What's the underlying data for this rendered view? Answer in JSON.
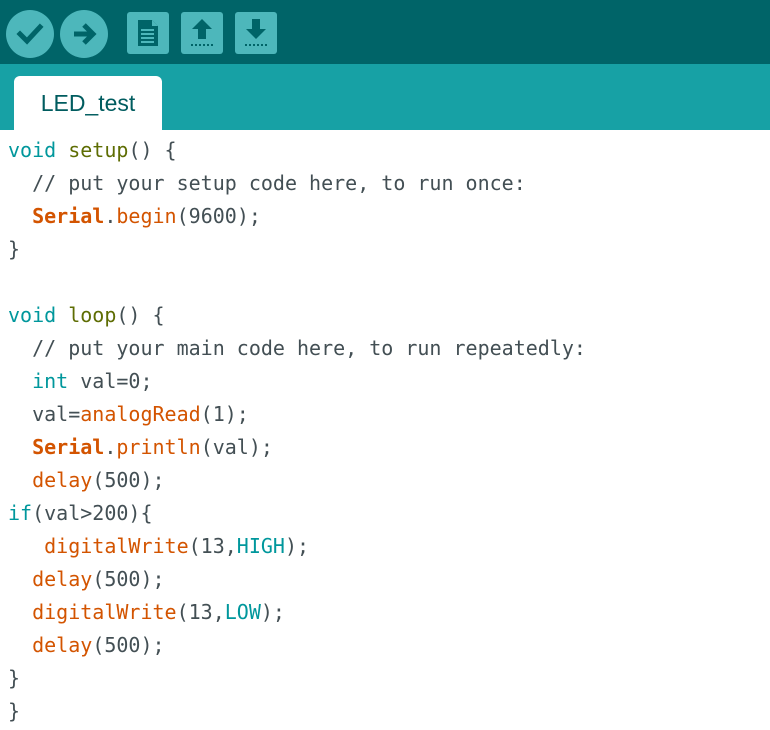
{
  "toolbar": {
    "buttons": [
      {
        "name": "verify",
        "icon": "check-icon"
      },
      {
        "name": "upload",
        "icon": "arrow-right-icon"
      },
      {
        "name": "new",
        "icon": "new-file-icon"
      },
      {
        "name": "open",
        "icon": "arrow-up-icon"
      },
      {
        "name": "save",
        "icon": "arrow-down-icon"
      }
    ],
    "colors": {
      "bar": "#006468",
      "button": "#4db7bb",
      "icon": "#006468"
    }
  },
  "tabs": [
    {
      "label": "LED_test",
      "active": true
    }
  ],
  "code": {
    "lines": [
      [
        [
          "kw",
          "void"
        ],
        [
          "p",
          " "
        ],
        [
          "st",
          "setup"
        ],
        [
          "p",
          "() {"
        ]
      ],
      [
        [
          "cm",
          "  // put your setup code here, to run once:"
        ]
      ],
      [
        [
          "p",
          "  "
        ],
        [
          "obj",
          "Serial"
        ],
        [
          "p",
          "."
        ],
        [
          "fn",
          "begin"
        ],
        [
          "p",
          "(9600);"
        ]
      ],
      [
        [
          "p",
          "}"
        ]
      ],
      [
        [
          "p",
          ""
        ]
      ],
      [
        [
          "kw",
          "void"
        ],
        [
          "p",
          " "
        ],
        [
          "st",
          "loop"
        ],
        [
          "p",
          "() {"
        ]
      ],
      [
        [
          "cm",
          "  // put your main code here, to run repeatedly:"
        ]
      ],
      [
        [
          "p",
          "  "
        ],
        [
          "kw",
          "int"
        ],
        [
          "p",
          " val=0;"
        ]
      ],
      [
        [
          "p",
          "  val="
        ],
        [
          "fn",
          "analogRead"
        ],
        [
          "p",
          "(1);"
        ]
      ],
      [
        [
          "p",
          "  "
        ],
        [
          "obj",
          "Serial"
        ],
        [
          "p",
          "."
        ],
        [
          "fn",
          "println"
        ],
        [
          "p",
          "(val);"
        ]
      ],
      [
        [
          "p",
          "  "
        ],
        [
          "fn",
          "delay"
        ],
        [
          "p",
          "(500);"
        ]
      ],
      [
        [
          "kw",
          "if"
        ],
        [
          "p",
          "(val>200){"
        ]
      ],
      [
        [
          "p",
          "   "
        ],
        [
          "fn",
          "digitalWrite"
        ],
        [
          "p",
          "(13,"
        ],
        [
          "const",
          "HIGH"
        ],
        [
          "p",
          ");"
        ]
      ],
      [
        [
          "p",
          "  "
        ],
        [
          "fn",
          "delay"
        ],
        [
          "p",
          "(500);"
        ]
      ],
      [
        [
          "p",
          "  "
        ],
        [
          "fn",
          "digitalWrite"
        ],
        [
          "p",
          "(13,"
        ],
        [
          "const",
          "LOW"
        ],
        [
          "p",
          ");"
        ]
      ],
      [
        [
          "p",
          "  "
        ],
        [
          "fn",
          "delay"
        ],
        [
          "p",
          "(500);"
        ]
      ],
      [
        [
          "p",
          "}"
        ]
      ],
      [
        [
          "p",
          "}"
        ]
      ]
    ],
    "colors": {
      "keyword": "#00979c",
      "function": "#d35400",
      "comment": "#434f54",
      "text": "#434f54",
      "structure": "#5e6d03"
    }
  }
}
